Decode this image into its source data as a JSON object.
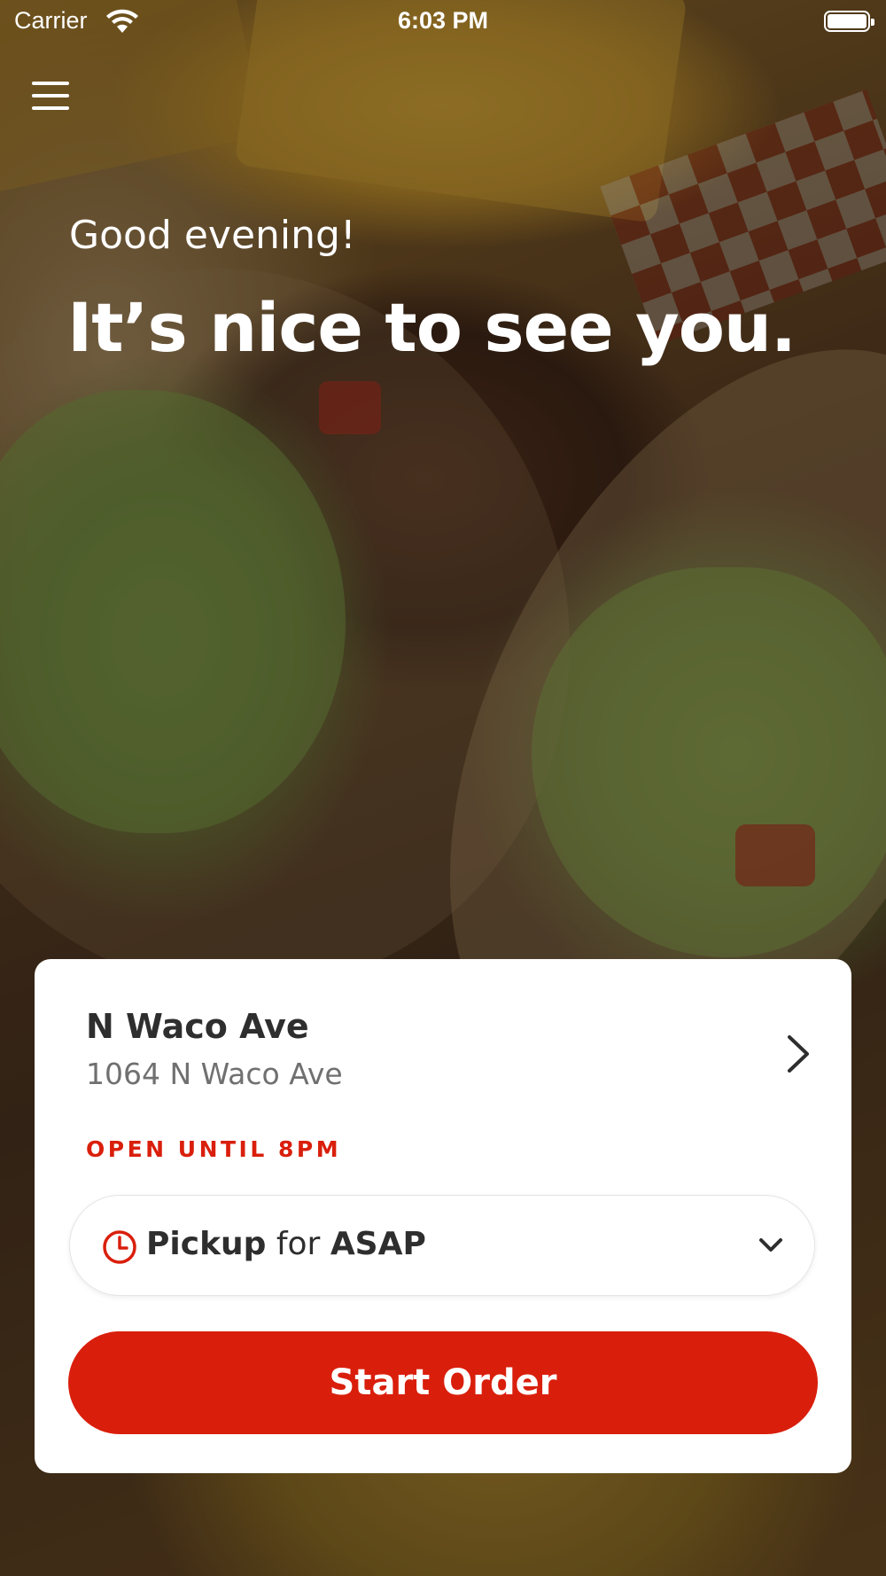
{
  "status_bar": {
    "carrier": "Carrier",
    "time": "6:03 PM",
    "wifi_icon": "wifi-icon",
    "battery_icon": "battery-icon"
  },
  "header": {
    "menu_icon": "hamburger-menu-icon",
    "greeting": "Good evening!",
    "headline": "It’s nice to see you."
  },
  "store": {
    "name": "N Waco Ave",
    "address": "1064 N Waco Ave",
    "hours": "OPEN UNTIL 8PM",
    "chevron_icon": "chevron-right-icon"
  },
  "order_mode": {
    "icon": "clock-icon",
    "mode": "Pickup",
    "connector": "for",
    "time": "ASAP",
    "dropdown_icon": "chevron-down-icon"
  },
  "actions": {
    "start_order_label": "Start Order"
  },
  "colors": {
    "accent": "#d91f0c",
    "text_dark": "#2e2e2e",
    "text_muted": "#707070",
    "card_bg": "#ffffff"
  }
}
